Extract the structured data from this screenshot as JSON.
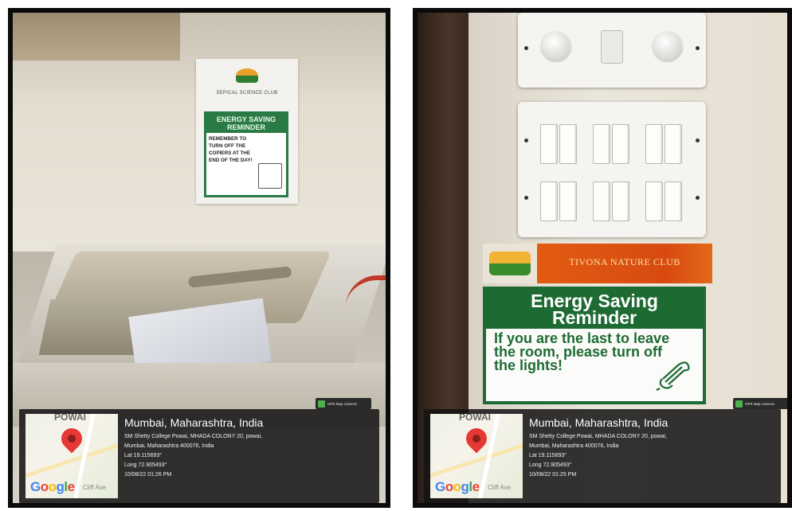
{
  "left_photo": {
    "poster": {
      "club": "SEPICAL SCIENCE CLUB",
      "title": "ENERGY SAVING REMINDER",
      "text": "REMEMBER TO TURN OFF THE COPIERS AT THE END OF THE DAY!"
    },
    "gps": {
      "badge": "GPS Map Camera",
      "map_area_label": "POWAI",
      "map_label": "Cliff Ave",
      "city": "Mumbai, Maharashtra, India",
      "address_1": "SM Shetty College Powai, MHADA COLONY 20, powai,",
      "address_2": "Mumbai, Maharashtra 400076, India",
      "lat": "Lat 19.115693°",
      "long": "Long 72.905493°",
      "timestamp": "10/08/22 01:26 PM"
    }
  },
  "right_photo": {
    "banner": "TIVONA NATURE CLUB",
    "sign": {
      "title_1": "Energy Saving",
      "title_2": "Reminder",
      "body": "If you are the last to leave the room, please turn off the lights!"
    },
    "gps": {
      "badge": "GPS Map Camera",
      "map_area_label": "POWAI",
      "map_label": "Cliff Ave",
      "city": "Mumbai, Maharashtra, India",
      "address_1": "SM Shetty College Powai, MHADA COLONY 20, powai,",
      "address_2": "Mumbai, Maharashtra 400076, India",
      "lat": "Lat 19.115693°",
      "long": "Long 72.905493°",
      "timestamp": "10/08/22 01:25 PM"
    }
  }
}
